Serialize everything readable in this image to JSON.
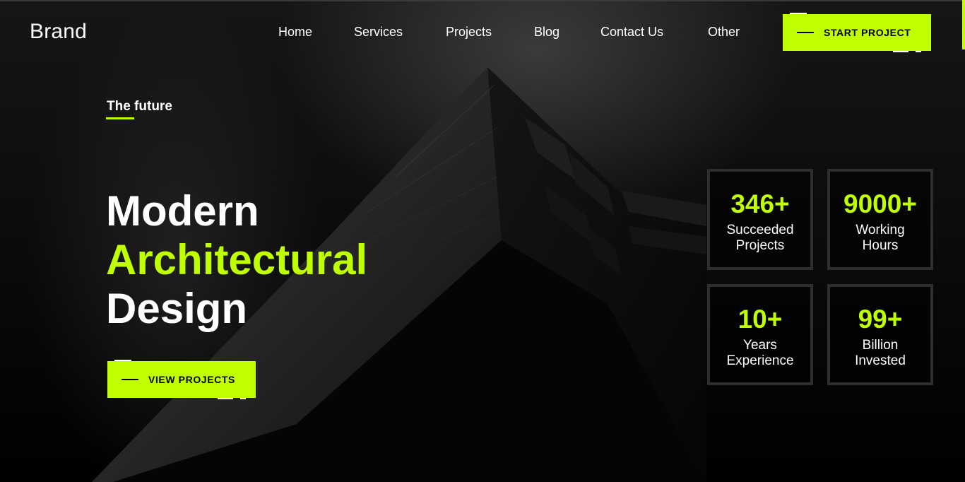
{
  "brand": "Brand",
  "nav": {
    "items": [
      "Home",
      "Services",
      "Projects",
      "Blog",
      "Contact Us",
      "Other"
    ],
    "cta_label": "START PROJECT"
  },
  "hero": {
    "tagline": "The future",
    "headline": {
      "line1": "Modern",
      "line2": "Architectural",
      "line3": "Design"
    },
    "cta_label": "VIEW PROJECTS"
  },
  "stats": [
    {
      "value": "346+",
      "label_line1": "Succeeded",
      "label_line2": "Projects"
    },
    {
      "value": "9000+",
      "label_line1": "Working",
      "label_line2": "Hours"
    },
    {
      "value": "10+",
      "label_line1": "Years",
      "label_line2": "Experience"
    },
    {
      "value": "99+",
      "label_line1": "Billion",
      "label_line2": "Invested"
    }
  ],
  "colors": {
    "accent": "#bfff00",
    "background": "#000000",
    "text": "#ffffff",
    "stat_border": "#2e2e2e"
  }
}
